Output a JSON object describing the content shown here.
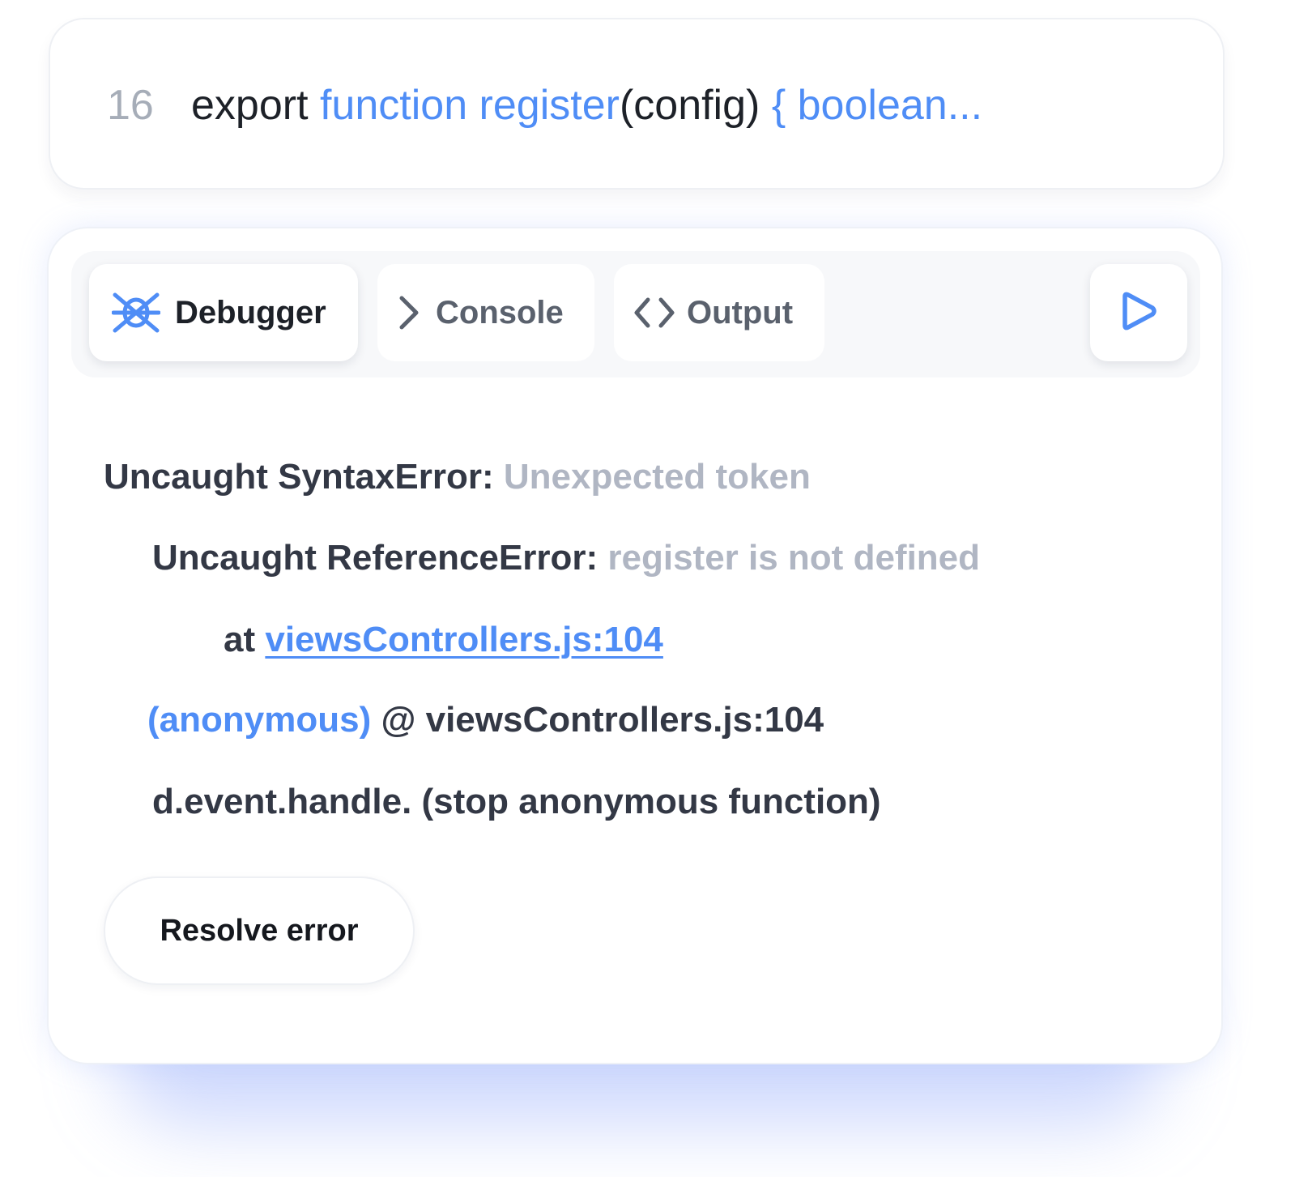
{
  "code": {
    "line_number": "16",
    "keyword": "export",
    "function_sig": "function register",
    "params": "(config)",
    "body_preview": "{ boolean..."
  },
  "tabs": [
    {
      "label": "Debugger",
      "icon": "bug-icon",
      "active": true
    },
    {
      "label": "Console",
      "icon": "chevron-right-icon",
      "active": false
    },
    {
      "label": "Output",
      "icon": "code-brackets-icon",
      "active": false
    }
  ],
  "run": {
    "icon": "play-icon"
  },
  "errors": {
    "syntax_label": "Uncaught SyntaxError:",
    "syntax_message": "Unexpected token",
    "reference_label": "Uncaught ReferenceError:",
    "reference_message": "register is not defined",
    "at_label": "at",
    "at_link": "viewsControllers.js:104",
    "anon_label": "(anonymous)",
    "anon_location": "@ viewsControllers.js:104",
    "handler_line": "d.event.handle. (stop anonymous function)"
  },
  "actions": {
    "resolve_label": "Resolve error"
  },
  "colors": {
    "accent": "#4f8df6",
    "muted": "#b0b6c3",
    "text": "#333845"
  }
}
